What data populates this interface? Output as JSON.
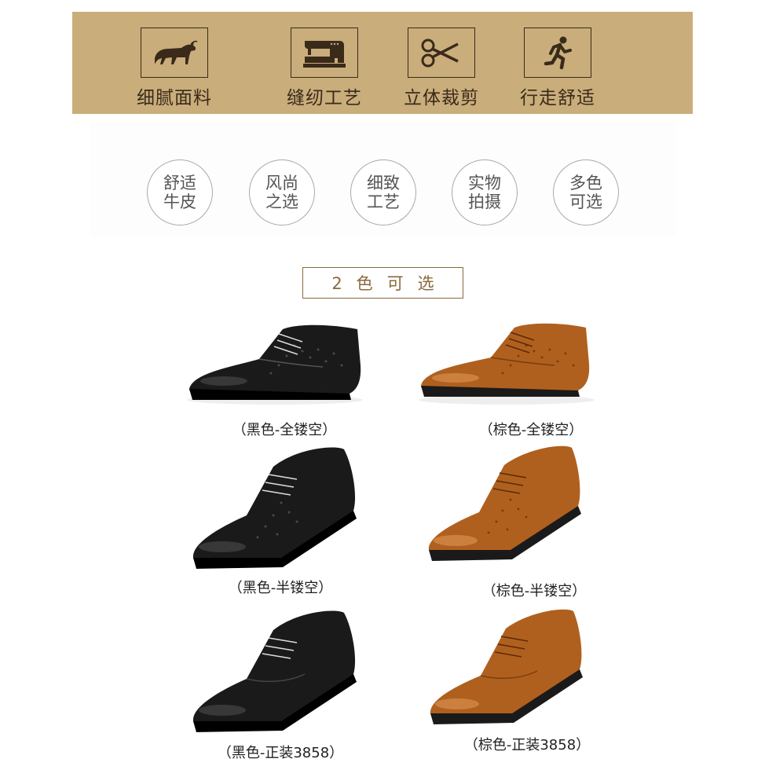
{
  "features": [
    {
      "icon": "bull-icon",
      "label": "细腻面料"
    },
    {
      "icon": "sewing-machine-icon",
      "label": "缝纫工艺"
    },
    {
      "icon": "scissors-icon",
      "label": "立体裁剪"
    },
    {
      "icon": "running-person-icon",
      "label": "行走舒适"
    }
  ],
  "badges": [
    {
      "line1": "舒适",
      "line2": "牛皮"
    },
    {
      "line1": "风尚",
      "line2": "之选"
    },
    {
      "line1": "细致",
      "line2": "工艺"
    },
    {
      "line1": "实物",
      "line2": "拍摄"
    },
    {
      "line1": "多色",
      "line2": "可选"
    }
  ],
  "section_title": "2色可选",
  "products": [
    {
      "caption": "（黑色-全镂空）",
      "color": "black",
      "style": "full-perforated"
    },
    {
      "caption": "（棕色-全镂空）",
      "color": "brown",
      "style": "full-perforated"
    },
    {
      "caption": "（黑色-半镂空）",
      "color": "black",
      "style": "half-perforated"
    },
    {
      "caption": "（棕色-半镂空）",
      "color": "brown",
      "style": "half-perforated"
    },
    {
      "caption": "（黑色-正装3858）",
      "color": "black",
      "style": "formal"
    },
    {
      "caption": "（棕色-正装3858）",
      "color": "brown",
      "style": "formal"
    }
  ],
  "colors": {
    "banner": "#c9ad7b",
    "banner_ink": "#3a2a1a",
    "title_accent": "#8a6a3e",
    "shoe_black": "#1a1a1a",
    "shoe_brown": "#b0601e"
  }
}
